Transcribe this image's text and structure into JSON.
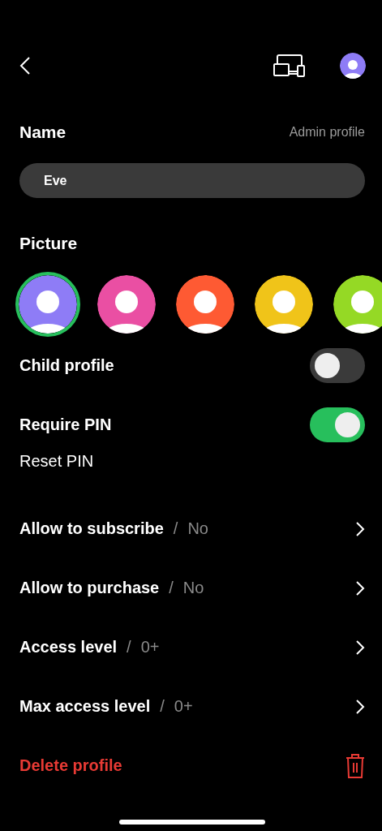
{
  "name_section": {
    "title": "Name",
    "hint": "Admin profile",
    "value": "Eve"
  },
  "picture_section": {
    "title": "Picture",
    "avatars": [
      {
        "color": "#8e7cf6",
        "selected": true
      },
      {
        "color": "#ea4fa3",
        "selected": false
      },
      {
        "color": "#fe5a33",
        "selected": false
      },
      {
        "color": "#f0c419",
        "selected": false
      },
      {
        "color": "#95d925",
        "selected": false
      }
    ]
  },
  "toggles": [
    {
      "label": "Child profile",
      "on": false
    },
    {
      "label": "Require PIN",
      "on": true
    }
  ],
  "reset_pin": "Reset PIN",
  "settings": [
    {
      "label": "Allow to subscribe",
      "separator": "/",
      "value": "No"
    },
    {
      "label": "Allow to purchase",
      "separator": "/",
      "value": "No"
    },
    {
      "label": "Access level",
      "separator": "/",
      "value": "0+"
    },
    {
      "label": "Max access level",
      "separator": "/",
      "value": "0+"
    }
  ],
  "delete_label": "Delete profile"
}
